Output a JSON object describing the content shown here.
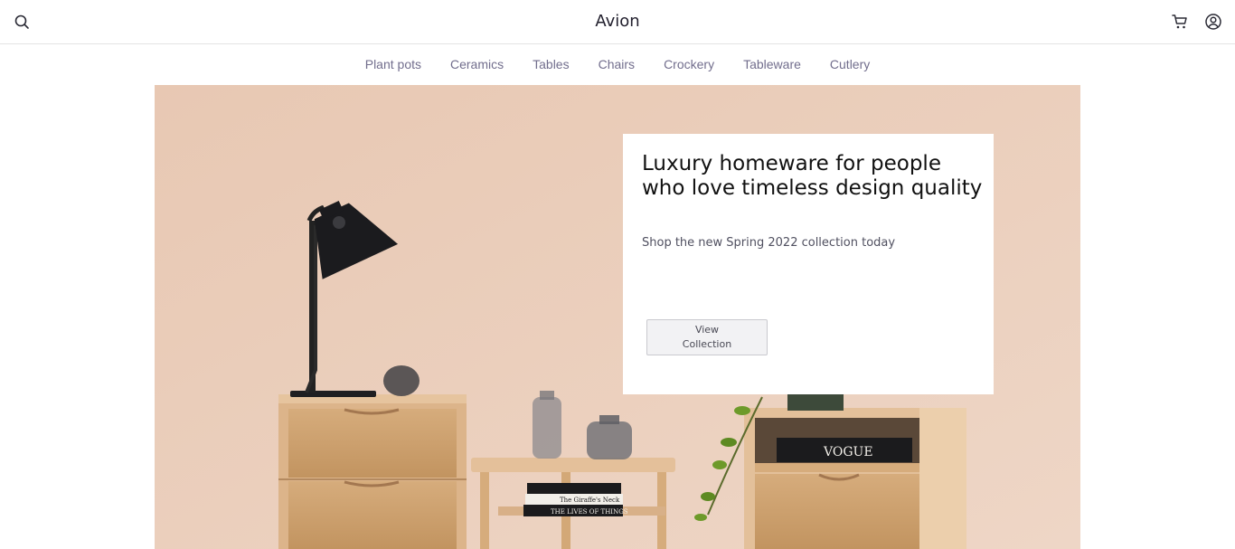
{
  "header": {
    "brand": "Avion",
    "search_icon": "search-icon",
    "cart_icon": "cart-icon",
    "account_icon": "user-circle-icon"
  },
  "categories": [
    "Plant pots",
    "Ceramics",
    "Tables",
    "Chairs",
    "Crockery",
    "Tableware",
    "Cutlery"
  ],
  "hero": {
    "headline": "Luxury homeware for people who love timeless design quality",
    "subtext": "Shop the new Spring 2022 collection today",
    "cta_label": "View\nCollection",
    "book_labels": [
      "VOGUE",
      "The Giraffe's Neck",
      "THE LIVES OF THINGS"
    ]
  },
  "colors": {
    "wall": "#e9cbb8",
    "nav_text": "#726e8d",
    "brand_text": "#22202e",
    "button_bg": "#f2f2f4"
  }
}
